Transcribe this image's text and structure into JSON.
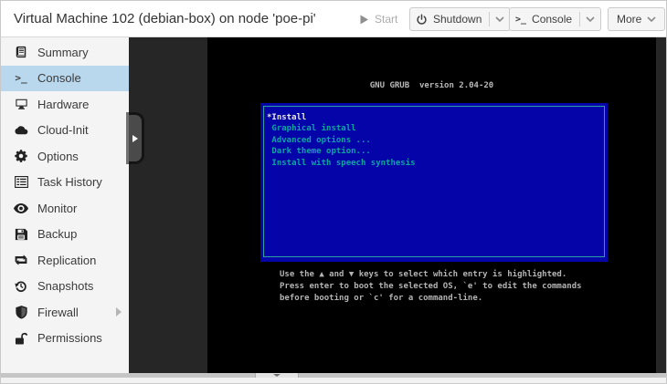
{
  "header": {
    "title": "Virtual Machine 102 (debian-box) on node 'poe-pi'",
    "start_label": "Start",
    "shutdown_label": "Shutdown",
    "console_label": "Console",
    "console_icon_text": ">_",
    "more_label": "More"
  },
  "sidebar": {
    "items": [
      {
        "label": "Summary",
        "icon": "book-icon",
        "selected": false
      },
      {
        "label": "Console",
        "icon": "terminal-icon",
        "selected": true
      },
      {
        "label": "Hardware",
        "icon": "display-icon",
        "selected": false
      },
      {
        "label": "Cloud-Init",
        "icon": "cloud-icon",
        "selected": false
      },
      {
        "label": "Options",
        "icon": "gear-icon",
        "selected": false
      },
      {
        "label": "Task History",
        "icon": "task-list-icon",
        "selected": false
      },
      {
        "label": "Monitor",
        "icon": "eye-icon",
        "selected": false
      },
      {
        "label": "Backup",
        "icon": "floppy-icon",
        "selected": false
      },
      {
        "label": "Replication",
        "icon": "replication-icon",
        "selected": false
      },
      {
        "label": "Snapshots",
        "icon": "snapshots-icon",
        "selected": false
      },
      {
        "label": "Firewall",
        "icon": "shield-icon",
        "selected": false,
        "has_submenu": true
      },
      {
        "label": "Permissions",
        "icon": "unlock-icon",
        "selected": false
      }
    ],
    "terminal_icon_text": ">_"
  },
  "console_screen": {
    "grub_title": "GNU GRUB  version 2.04-20",
    "menu_items": [
      {
        "label": "*Install",
        "selected": true
      },
      {
        "label": " Graphical install",
        "selected": false
      },
      {
        "label": " Advanced options ...",
        "selected": false
      },
      {
        "label": " Dark theme option...",
        "selected": false
      },
      {
        "label": " Install with speech synthesis",
        "selected": false
      }
    ],
    "help_lines": [
      "Use the ▲ and ▼ keys to select which entry is highlighted.",
      "Press enter to boot the selected OS, `e' to edit the commands",
      "before booting or `c' for a command-line."
    ],
    "colors": {
      "menu_bg": "#0404a8",
      "menu_border": "#2fa0a0",
      "menu_text": "#0aa4a4",
      "menu_selected_text": "#e9e9e9",
      "screen_text": "#b4b4b4",
      "screen_bg": "#000000"
    }
  }
}
